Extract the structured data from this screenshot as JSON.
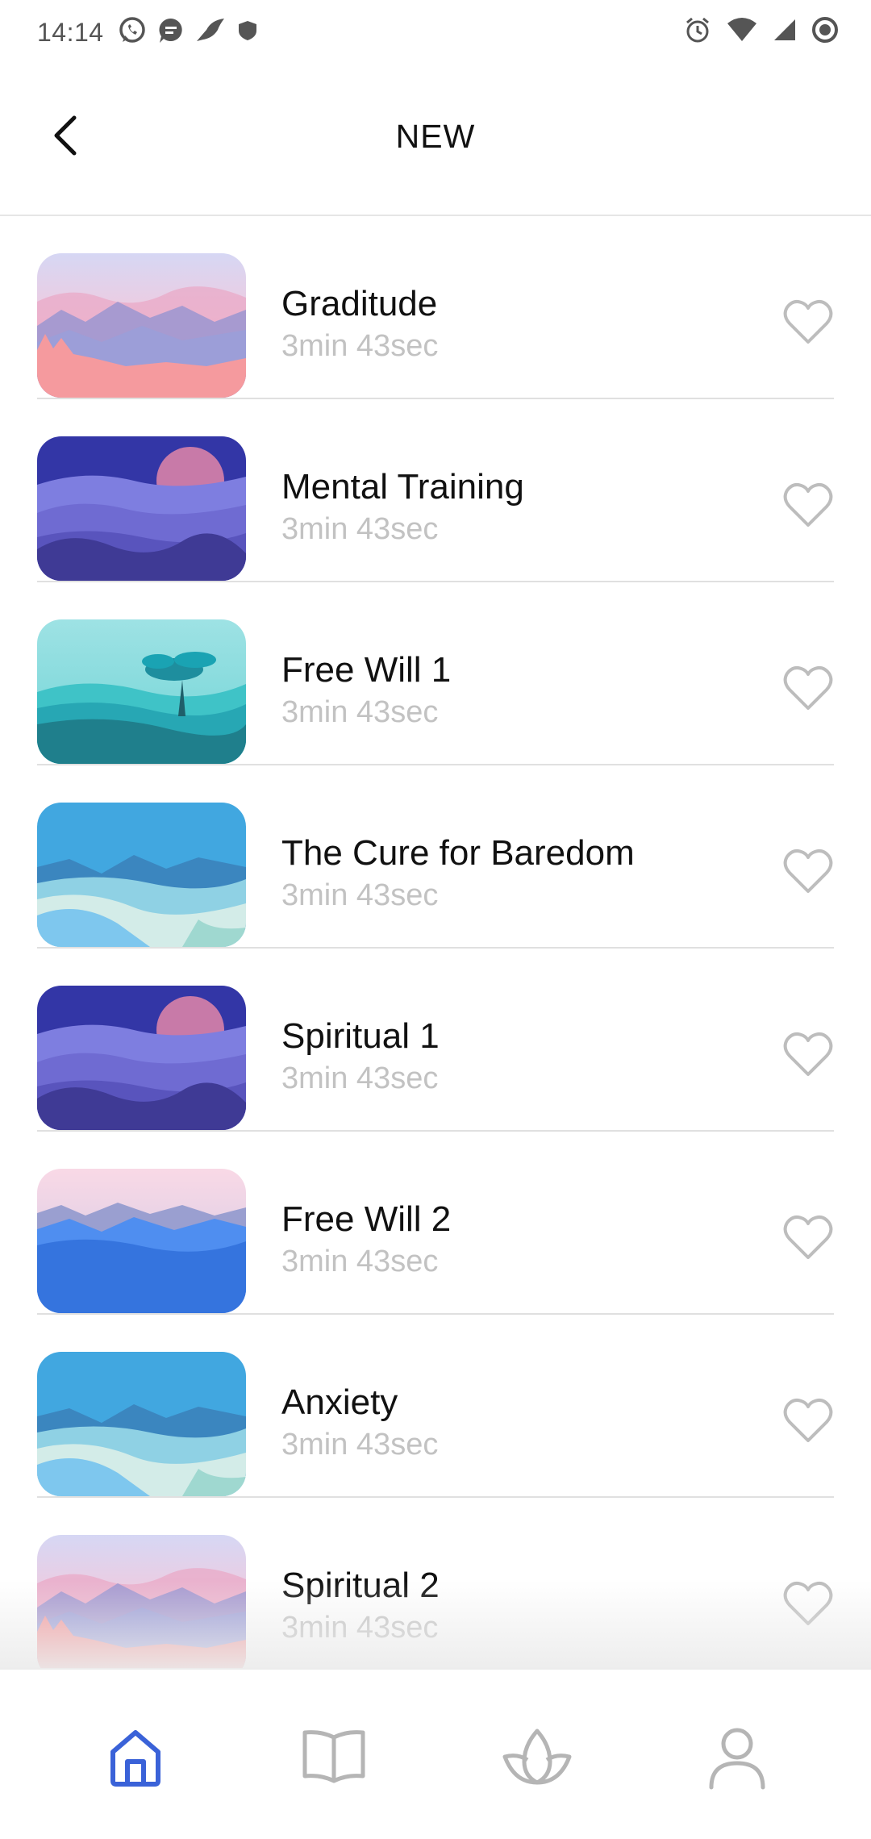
{
  "status_bar": {
    "time": "14:14",
    "left_icons": [
      "whatsapp-icon",
      "message-icon",
      "bird-icon",
      "shield-icon"
    ],
    "right_icons": [
      "alarm-icon",
      "wifi-icon",
      "signal-icon",
      "record-icon"
    ]
  },
  "header": {
    "title": "NEW",
    "back_icon": "chevron-left-icon"
  },
  "list": [
    {
      "title": "Graditude",
      "duration": "3min 43sec",
      "thumbnail": "pink-mountains"
    },
    {
      "title": "Mental Training",
      "duration": "3min 43sec",
      "thumbnail": "purple-sunset"
    },
    {
      "title": "Free Will 1",
      "duration": "3min 43sec",
      "thumbnail": "teal-tree"
    },
    {
      "title": "The Cure for Baredom",
      "duration": "3min 43sec",
      "thumbnail": "blue-valley"
    },
    {
      "title": "Spiritual 1",
      "duration": "3min 43sec",
      "thumbnail": "purple-sunset"
    },
    {
      "title": "Free Will 2",
      "duration": "3min 43sec",
      "thumbnail": "blue-pink-horizon"
    },
    {
      "title": "Anxiety",
      "duration": "3min 43sec",
      "thumbnail": "blue-valley"
    },
    {
      "title": "Spiritual 2",
      "duration": "3min 43sec",
      "thumbnail": "pink-mountains"
    }
  ],
  "bottom_nav": [
    {
      "icon": "home-icon",
      "active": true
    },
    {
      "icon": "book-icon",
      "active": false
    },
    {
      "icon": "lotus-icon",
      "active": false
    },
    {
      "icon": "profile-icon",
      "active": false
    }
  ],
  "colors": {
    "accent": "#3a62d8",
    "inactive": "#b5b5b5",
    "subtext": "#c2c2c2",
    "divider": "#e0e0e0"
  }
}
